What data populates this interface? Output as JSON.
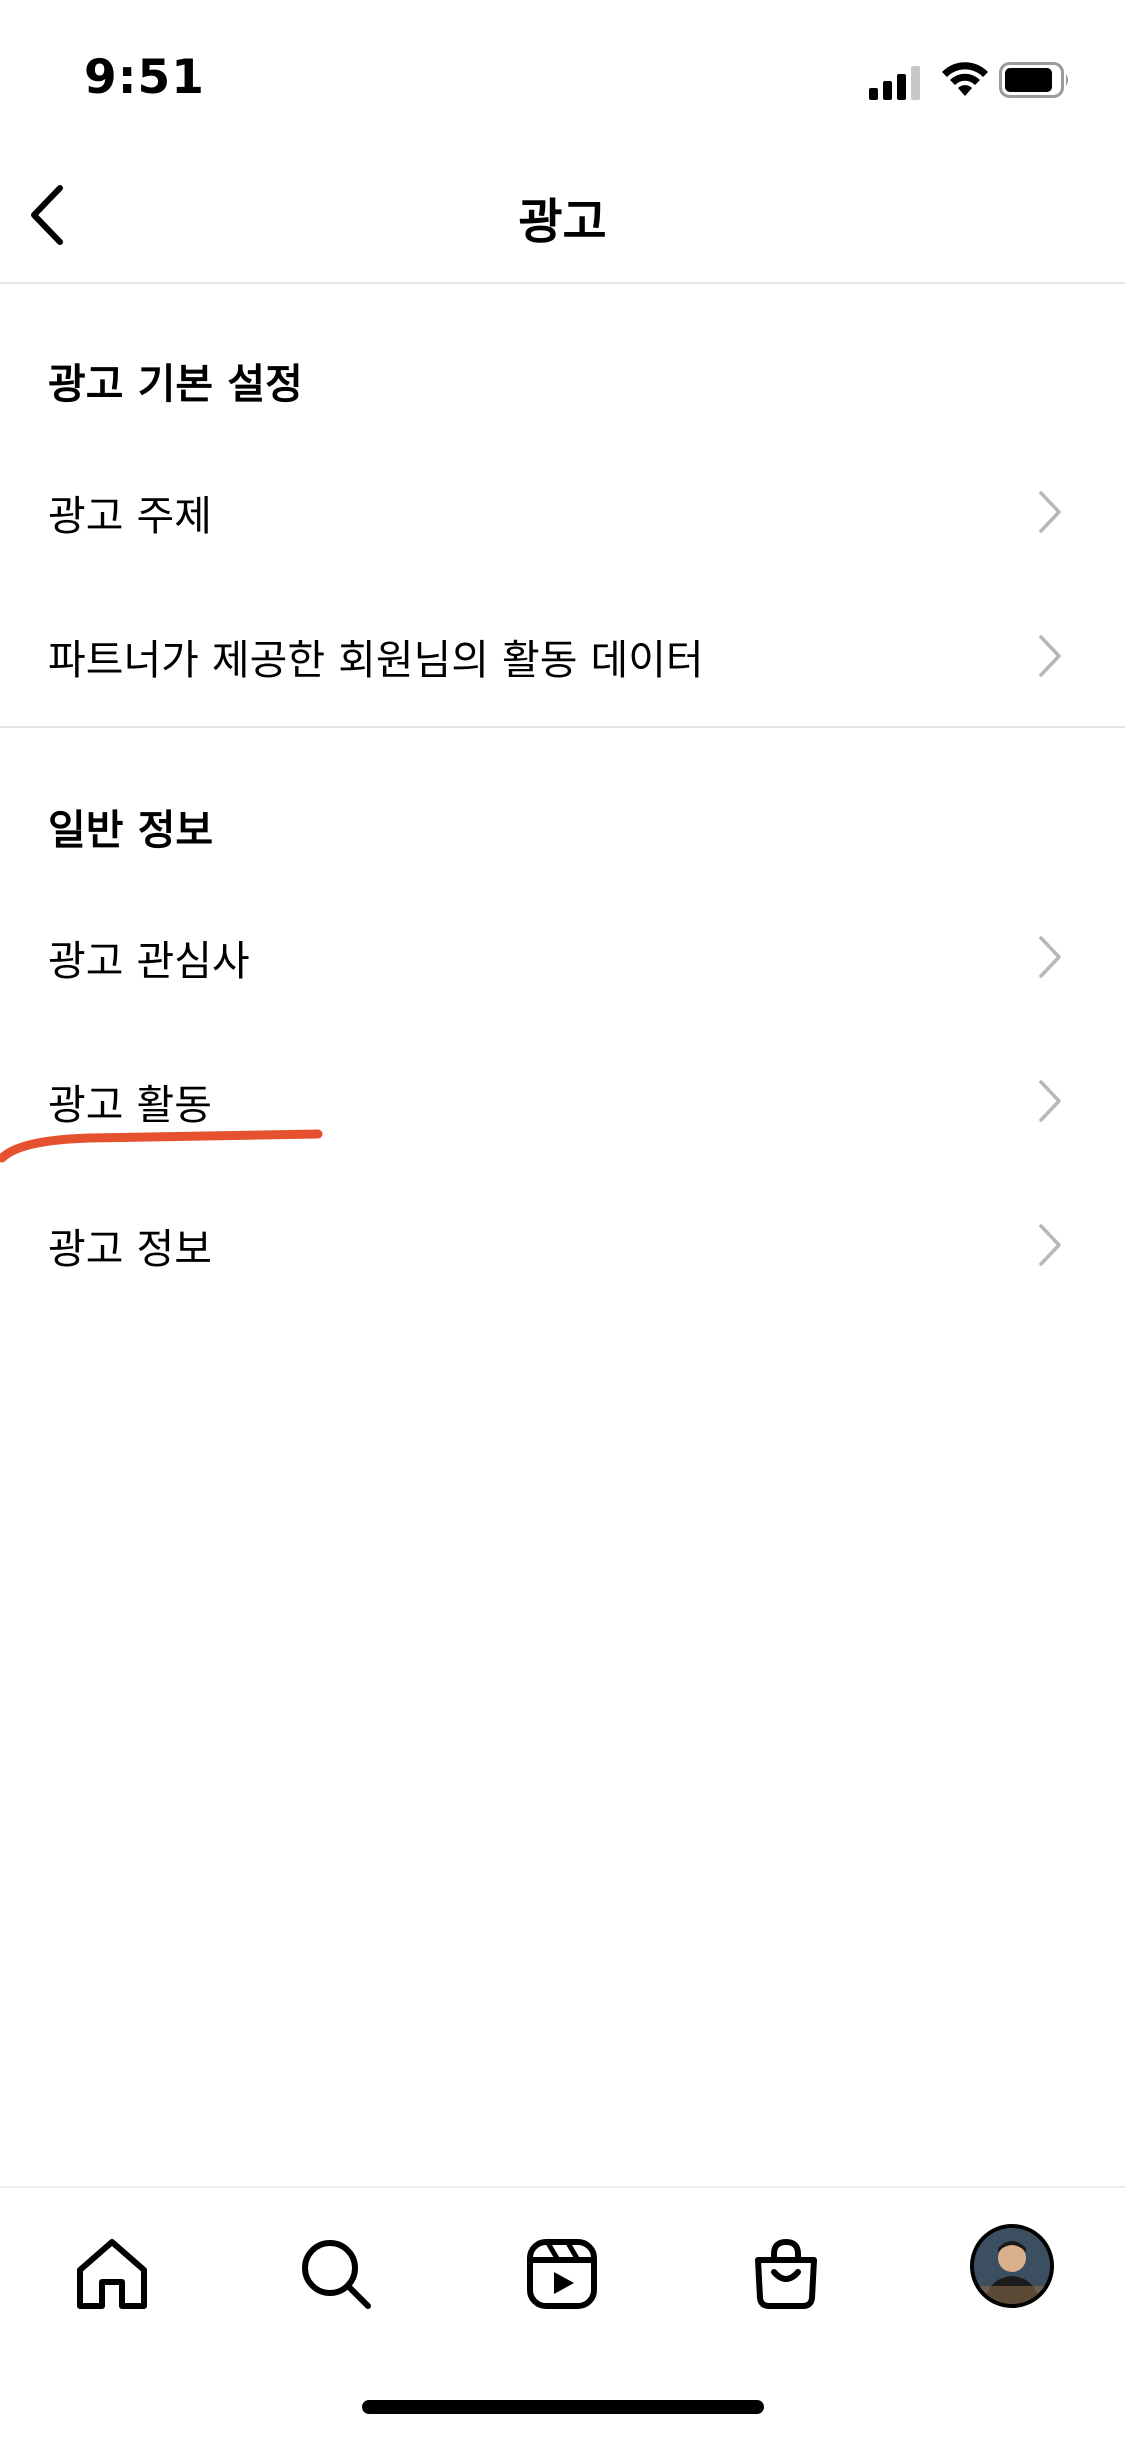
{
  "status_bar": {
    "time": "9:51",
    "icons": [
      "cellular-signal-icon",
      "wifi-icon",
      "battery-icon"
    ]
  },
  "header": {
    "title": "광고",
    "back_icon": "chevron-left-icon"
  },
  "sections": [
    {
      "title": "광고 기본 설정",
      "items": [
        {
          "label": "광고 주제"
        },
        {
          "label": "파트너가 제공한 회원님의 활동 데이터"
        }
      ]
    },
    {
      "title": "일반 정보",
      "items": [
        {
          "label": "광고 관심사"
        },
        {
          "label": "광고 활동"
        },
        {
          "label": "광고 정보"
        }
      ]
    }
  ],
  "annotation": {
    "color": "#e5502e",
    "marks_item": "광고 활동"
  },
  "tab_bar": {
    "tabs": [
      "home-icon",
      "search-icon",
      "reels-icon",
      "shop-icon",
      "profile-avatar"
    ]
  },
  "colors": {
    "text": "#000000",
    "chevron": "#b8b8b8",
    "divider": "#e2e2e2",
    "annotation": "#e5502e"
  }
}
